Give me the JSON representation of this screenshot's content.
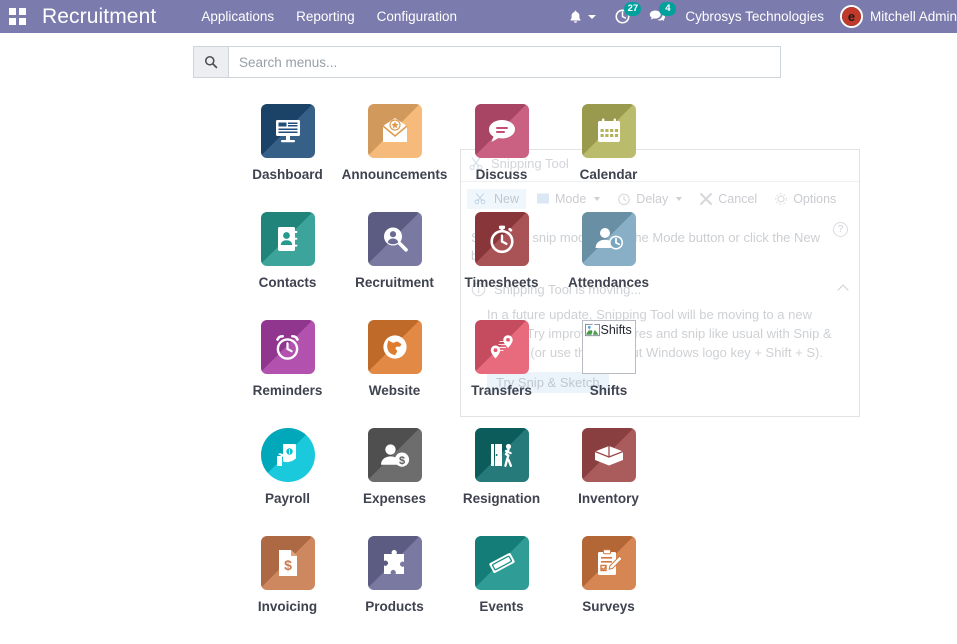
{
  "navbar": {
    "apps_icon": "apps-grid-icon",
    "brand": "Recruitment",
    "menus": [
      {
        "label": "Applications"
      },
      {
        "label": "Reporting"
      },
      {
        "label": "Configuration"
      }
    ],
    "activities_icon": "bell-icon",
    "timer_icon": "timer-icon",
    "timer_badge": "27",
    "messages_icon": "chat-icon",
    "messages_badge": "4",
    "company": "Cybrosys Technologies",
    "user": "Mitchell Admin",
    "avatar_initial": "e",
    "accent_color": "#7c7bad",
    "badge_color": "#00a09d"
  },
  "search": {
    "icon": "search-icon",
    "placeholder": "Search menus...",
    "value": ""
  },
  "apps": [
    [
      {
        "label": "Dashboard",
        "icon": "dashboard-icon",
        "color": "#1f4e79",
        "shape": "square"
      },
      {
        "label": "Announcements",
        "icon": "envelope-star-icon",
        "color": "#f5b26b",
        "shape": "square"
      },
      {
        "label": "Discuss",
        "icon": "chat-bubble-icon",
        "color": "#c44f74",
        "shape": "square"
      },
      {
        "label": "Calendar",
        "icon": "calendar-icon",
        "color": "#b3b35c",
        "shape": "square"
      }
    ],
    [
      {
        "label": "Contacts",
        "icon": "address-book-icon",
        "color": "#269a8e",
        "shape": "square"
      },
      {
        "label": "Recruitment",
        "icon": "user-search-icon",
        "color": "#6b6a96",
        "shape": "square"
      },
      {
        "label": "Timesheets",
        "icon": "stopwatch-icon",
        "color": "#9e3f42",
        "shape": "square"
      },
      {
        "label": "Attendances",
        "icon": "user-clock-icon",
        "color": "#7aa6c0",
        "shape": "square"
      }
    ],
    [
      {
        "label": "Reminders",
        "icon": "alarm-clock-icon",
        "color": "#a93fa5",
        "shape": "square"
      },
      {
        "label": "Website",
        "icon": "globe-icon",
        "color": "#df7c30",
        "shape": "square"
      },
      {
        "label": "Transfers",
        "icon": "map-pin-icon",
        "color": "#e4596e",
        "shape": "square"
      },
      {
        "label": "Shifts",
        "icon": "broken-image-icon",
        "color": "#ffffff",
        "shape": "broken",
        "alt": "Shifts"
      }
    ],
    [
      {
        "label": "Payroll",
        "icon": "money-hand-icon",
        "color": "#00c4d8",
        "shape": "circle"
      },
      {
        "label": "Expenses",
        "icon": "user-dollar-icon",
        "color": "#5c5c5c",
        "shape": "square"
      },
      {
        "label": "Resignation",
        "icon": "door-exit-icon",
        "color": "#0e6b6b",
        "shape": "square"
      },
      {
        "label": "Inventory",
        "icon": "open-box-icon",
        "color": "#a0494a",
        "shape": "square"
      }
    ],
    [
      {
        "label": "Invoicing",
        "icon": "invoice-dollar-icon",
        "color": "#c97a4e",
        "shape": "square"
      },
      {
        "label": "Products",
        "icon": "puzzle-piece-icon",
        "color": "#6b6a96",
        "shape": "square"
      },
      {
        "label": "Events",
        "icon": "ticket-icon",
        "color": "#18918a",
        "shape": "square"
      },
      {
        "label": "Surveys",
        "icon": "clipboard-pen-icon",
        "color": "#d2783f",
        "shape": "square"
      }
    ]
  ],
  "snipping_tool": {
    "title": "Snipping Tool",
    "buttons": [
      {
        "label": "New"
      },
      {
        "label": "Mode"
      },
      {
        "label": "Delay"
      },
      {
        "label": "Cancel"
      },
      {
        "label": "Options"
      }
    ],
    "hint": "Select the snip mode using the Mode button or click the New button.",
    "help_glyph": "?",
    "notification_title": "Snipping Tool is moving...",
    "notification_body": "In a future update, Snipping Tool will be moving to a new home. Try improved features and snip like usual with Snip & Sketch (or use the shortcut Windows logo key + Shift + S).",
    "notification_button": "Try Snip & Sketch"
  }
}
